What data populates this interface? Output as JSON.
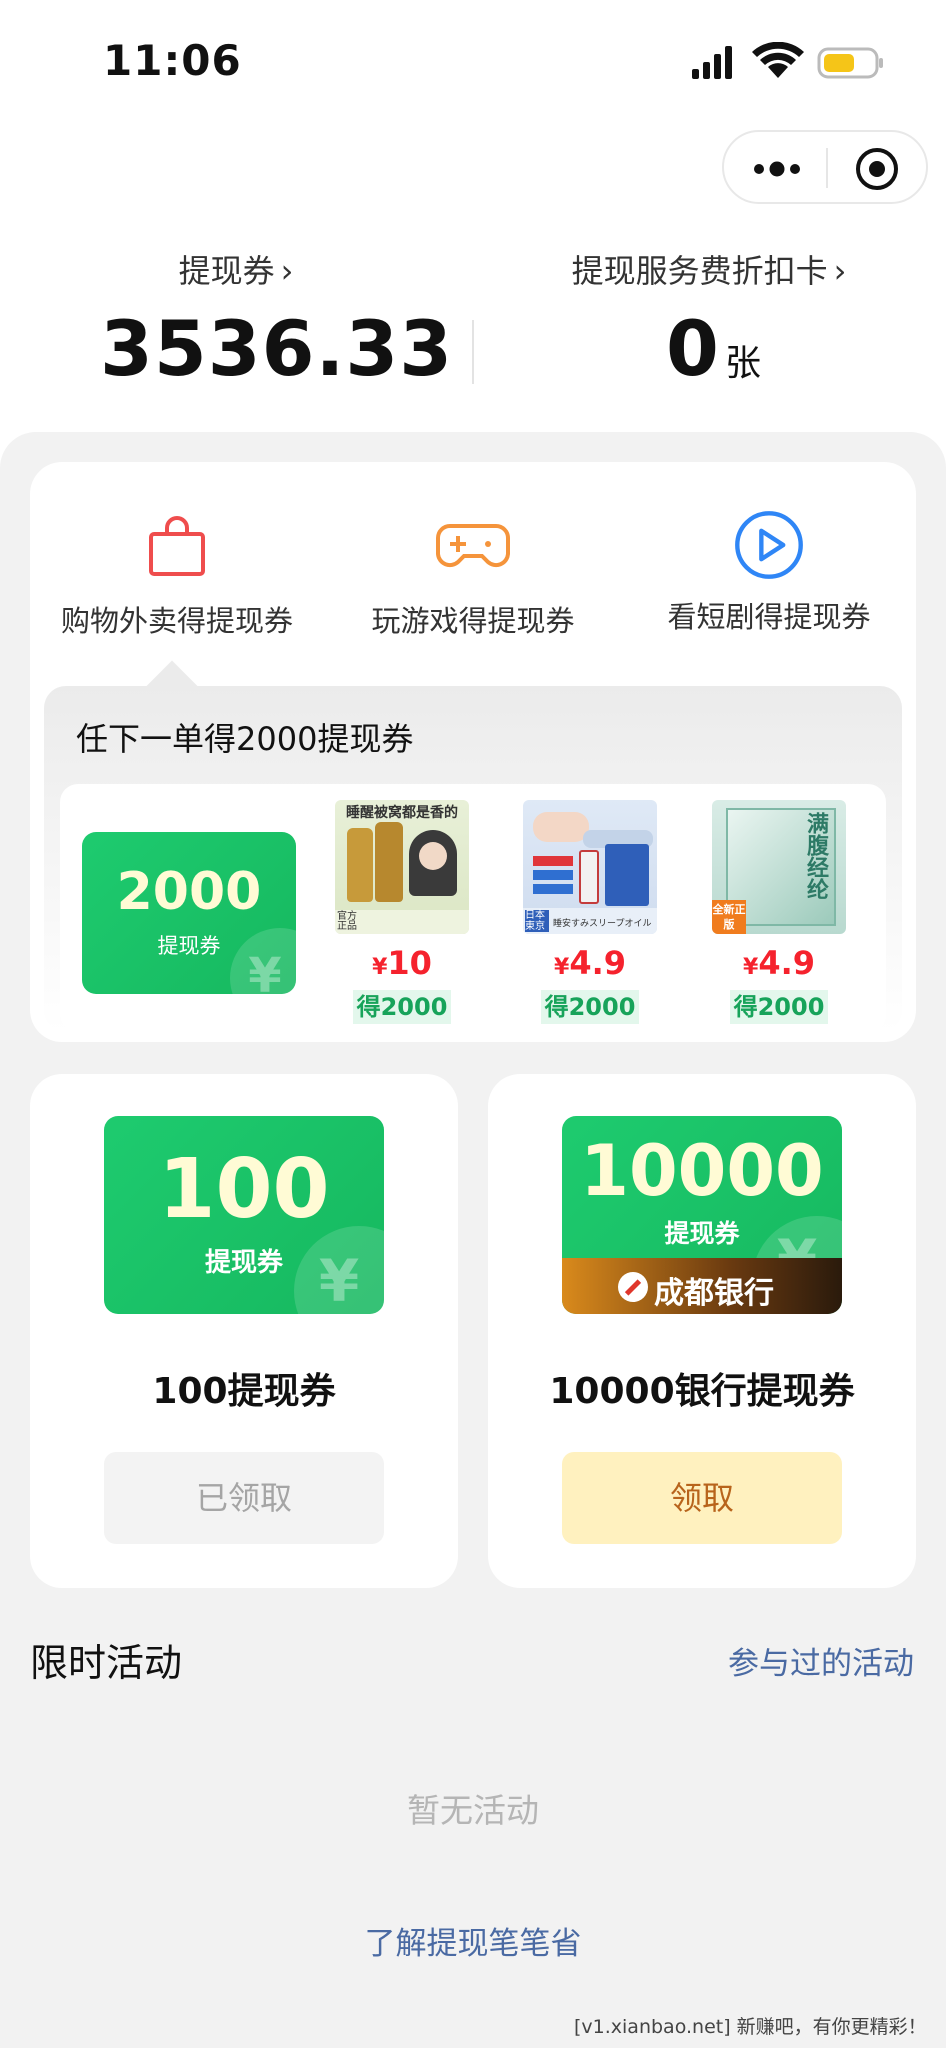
{
  "status_bar": {
    "time": "11:06"
  },
  "header": {
    "voucher_label": "提现券",
    "voucher_value": "3536.33",
    "discount_card_label": "提现服务费折扣卡",
    "discount_card_value": "0",
    "discount_card_unit": "张"
  },
  "categories": [
    {
      "label": "购物外卖得提现券",
      "icon": "shopping-bag-icon",
      "color": "#ef4d4d"
    },
    {
      "label": "玩游戏得提现券",
      "icon": "gamepad-icon",
      "color": "#f5943b"
    },
    {
      "label": "看短剧得提现券",
      "icon": "play-icon",
      "color": "#2f86f6"
    }
  ],
  "promo": {
    "title": "任下一单得2000提现券",
    "coupon_amount": "2000",
    "coupon_label": "提现券",
    "products": [
      {
        "price_symbol": "¥",
        "price": "10",
        "reward": "得2000",
        "img_caption": "睡醒被窝都是香的",
        "img_tag": "官方正品"
      },
      {
        "price_symbol": "¥",
        "price": "4.9",
        "reward": "得2000",
        "img_caption": "睡安すみスリープオイル",
        "img_tag": "日本東京"
      },
      {
        "price_symbol": "¥",
        "price": "4.9",
        "reward": "得2000",
        "img_caption": "满腹经纶",
        "img_tag": "全新正版"
      }
    ]
  },
  "coupons": [
    {
      "amount": "100",
      "label": "提现券",
      "title": "100提现券",
      "button": "已领取",
      "claimed": true
    },
    {
      "amount": "10000",
      "label": "提现券",
      "bank": "成都银行",
      "title": "10000银行提现券",
      "button": "领取",
      "claimed": false
    }
  ],
  "activities": {
    "title": "限时活动",
    "link": "参与过的活动",
    "empty": "暂无活动"
  },
  "footer_link": "了解提现笔笔省",
  "watermark": "[v1.xianbao.net] 新赚吧，有你更精彩！",
  "colors": {
    "green": "#1ecb6f",
    "red_price": "#f5222d",
    "link": "#4a6aa3",
    "claim_bg": "#fff1bf",
    "claim_text": "#b8641c"
  }
}
